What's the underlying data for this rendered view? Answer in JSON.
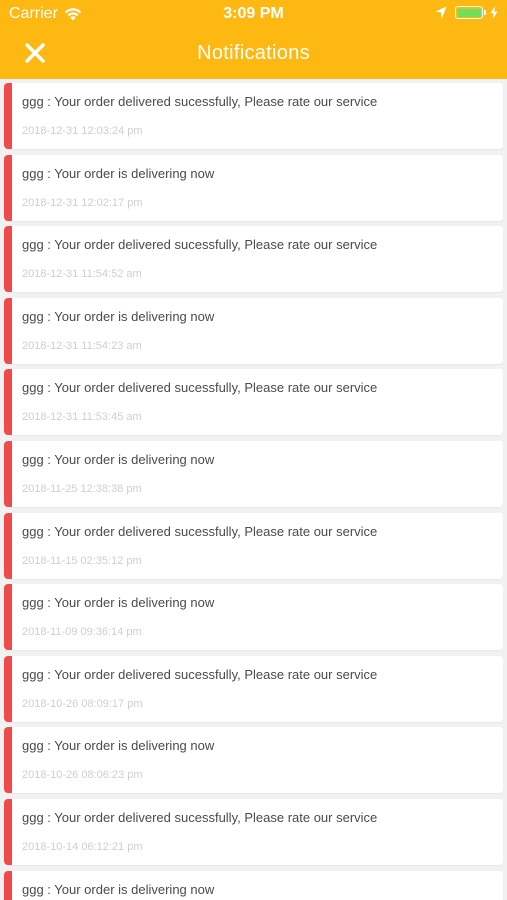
{
  "status_bar": {
    "carrier": "Carrier",
    "time": "3:09 PM",
    "battery_level": 1.0,
    "battery_color": "#6ee05a"
  },
  "header": {
    "title": "Notifications",
    "close_icon": "close-icon",
    "background": "#fdb812"
  },
  "accent_color": "#ef4b4b",
  "notifications": [
    {
      "message": "ggg : Your order delivered sucessfully, Please rate our service",
      "time": "2018-12-31 12:03:24 pm"
    },
    {
      "message": "ggg : Your order is delivering now",
      "time": "2018-12-31 12:02:17 pm"
    },
    {
      "message": "ggg : Your order delivered sucessfully, Please rate our service",
      "time": "2018-12-31 11:54:52 am"
    },
    {
      "message": "ggg : Your order is delivering now",
      "time": "2018-12-31 11:54:23 am"
    },
    {
      "message": "ggg : Your order delivered sucessfully, Please rate our service",
      "time": "2018-12-31 11:53:45 am"
    },
    {
      "message": "ggg : Your order is delivering now",
      "time": "2018-11-25 12:38:38 pm"
    },
    {
      "message": "ggg : Your order delivered sucessfully, Please rate our service",
      "time": "2018-11-15 02:35:12 pm"
    },
    {
      "message": "ggg : Your order is delivering now",
      "time": "2018-11-09 09:36:14 pm"
    },
    {
      "message": "ggg : Your order delivered sucessfully, Please rate our service",
      "time": "2018-10-26 08:09:17 pm"
    },
    {
      "message": "ggg : Your order is delivering now",
      "time": "2018-10-26 08:06:23 pm"
    },
    {
      "message": "ggg : Your order delivered sucessfully, Please rate our service",
      "time": "2018-10-14 06:12:21 pm"
    },
    {
      "message": "ggg : Your order is delivering now",
      "time": ""
    }
  ]
}
